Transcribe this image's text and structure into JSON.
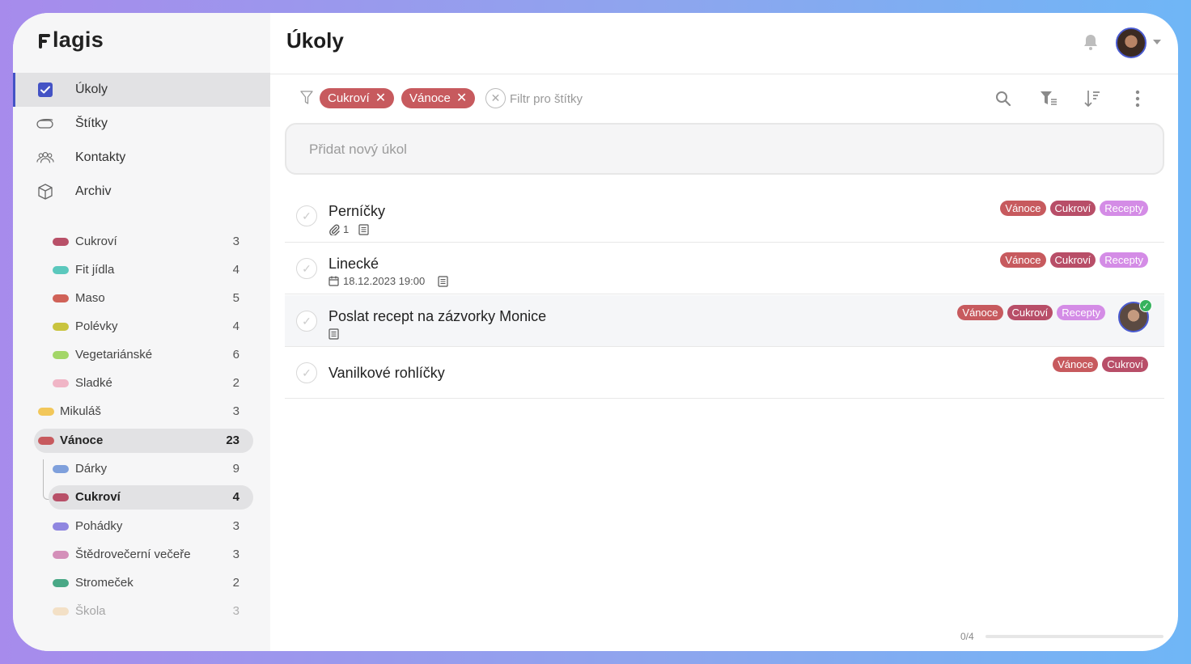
{
  "app": {
    "name": "Flagis"
  },
  "nav": [
    {
      "label": "Úkoly",
      "icon": "checkbox-icon",
      "active": true
    },
    {
      "label": "Štítky",
      "icon": "tag-icon",
      "active": false
    },
    {
      "label": "Kontakty",
      "icon": "contacts-icon",
      "active": false
    },
    {
      "label": "Archiv",
      "icon": "archive-icon",
      "active": false
    }
  ],
  "tags": [
    {
      "label": "Cukroví",
      "count": "3",
      "color": "#b85068"
    },
    {
      "label": "Fit jídla",
      "count": "4",
      "color": "#5bc8bd"
    },
    {
      "label": "Maso",
      "count": "5",
      "color": "#d06258"
    },
    {
      "label": "Polévky",
      "count": "4",
      "color": "#c9c43f"
    },
    {
      "label": "Vegetariánské",
      "count": "6",
      "color": "#a3d668"
    },
    {
      "label": "Sladké",
      "count": "2",
      "color": "#f0b5c6"
    },
    {
      "label": "Mikuláš",
      "count": "3",
      "color": "#f2c75a"
    },
    {
      "label": "Vánoce",
      "count": "23",
      "color": "#c75a5e"
    },
    {
      "label": "Dárky",
      "count": "9",
      "color": "#7fa0dc"
    },
    {
      "label": "Cukroví",
      "count": "4",
      "color": "#b85068"
    },
    {
      "label": "Pohádky",
      "count": "3",
      "color": "#8f86e0"
    },
    {
      "label": "Štědrovečerní večeře",
      "count": "3",
      "color": "#d48fb9"
    },
    {
      "label": "Stromeček",
      "count": "2",
      "color": "#49a886"
    },
    {
      "label": "Škola",
      "count": "3",
      "color": "#f0c68a"
    }
  ],
  "header": {
    "title": "Úkoly"
  },
  "filter": {
    "chips": [
      "Cukroví",
      "Vánoce"
    ],
    "placeholder": "Filtr pro štítky"
  },
  "add_task": {
    "placeholder": "Přidat nový úkol"
  },
  "tasks": [
    {
      "title": "Perníčky",
      "attachments": "1",
      "labels": [
        "Vánoce",
        "Cukroví",
        "Recepty"
      ]
    },
    {
      "title": "Linecké",
      "date": "18.12.2023 19:00",
      "labels": [
        "Vánoce",
        "Cukroví",
        "Recepty"
      ]
    },
    {
      "title": "Poslat recept na zázvorky Monice",
      "labels": [
        "Vánoce",
        "Cukroví",
        "Recepty"
      ]
    },
    {
      "title": "Vanilkové rohlíčky",
      "labels": [
        "Vánoce",
        "Cukroví"
      ]
    }
  ],
  "progress": {
    "text": "0/4",
    "fraction": 0
  },
  "colors": {
    "accent": "#4453c5",
    "label_vanoce": "#c75a5e",
    "label_cukrovi": "#b84e68",
    "label_recepty": "#d48ce6"
  }
}
